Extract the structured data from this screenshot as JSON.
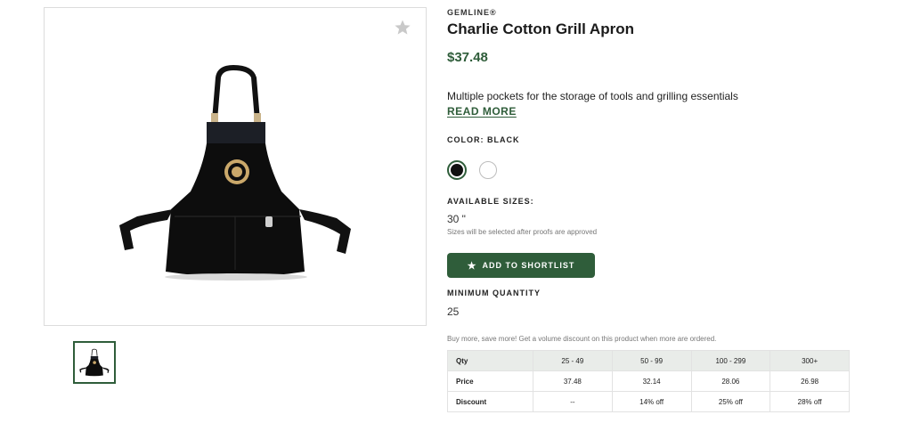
{
  "product": {
    "brand": "GEMLINE®",
    "title": "Charlie Cotton Grill Apron",
    "price": "$37.48",
    "description": "Multiple pockets for the storage of tools and grilling essentials",
    "read_more_label": "READ MORE"
  },
  "color": {
    "label": "COLOR: BLACK",
    "swatches": [
      {
        "name": "Black",
        "hex": "#111111",
        "selected": true
      },
      {
        "name": "White",
        "hex": "#ffffff",
        "selected": false
      }
    ]
  },
  "sizes": {
    "label": "AVAILABLE SIZES:",
    "value": "30 \"",
    "note": "Sizes will be selected after proofs are approved"
  },
  "shortlist_button": {
    "label": "ADD TO SHORTLIST",
    "icon": "star-icon"
  },
  "min_quantity": {
    "label": "MINIMUM QUANTITY",
    "value": "25"
  },
  "volume_note": "Buy more, save more! Get a volume discount on this product when more are ordered.",
  "pricing_table": {
    "headers": [
      "Qty",
      "25 - 49",
      "50 - 99",
      "100 - 299",
      "300+"
    ],
    "rows": [
      {
        "label": "Price",
        "cells": [
          "37.48",
          "32.14",
          "28.06",
          "26.98"
        ]
      },
      {
        "label": "Discount",
        "cells": [
          "--",
          "14% off",
          "25% off",
          "28% off"
        ]
      }
    ]
  },
  "colors": {
    "accent": "#2f5d3a",
    "table_header_bg": "#e9ece9"
  }
}
